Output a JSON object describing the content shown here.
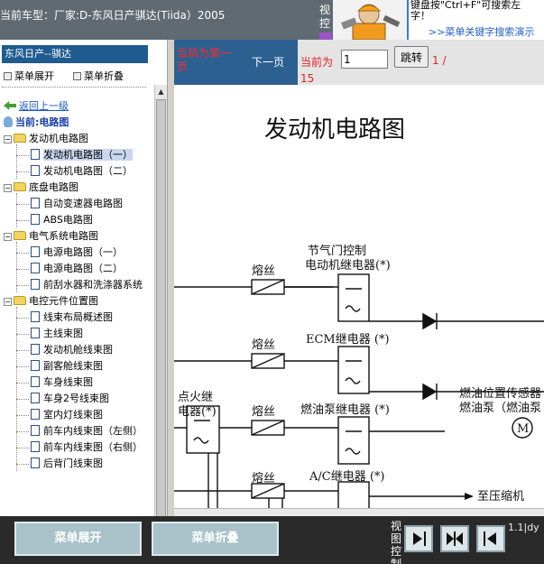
{
  "header": {
    "title": "当前车型：厂家:D-东风日产骐达(Tiida）2005",
    "view_control": "视控",
    "tip_line1": "键盘按\"Ctrl+F\"可搜索左",
    "tip_line2": "字！",
    "tip_link": ">>菜单关键字搜索演示"
  },
  "sidebar": {
    "car_title": "东风日产--骐达",
    "expand_label": "菜单展开",
    "collapse_label": "菜单折叠",
    "back_label": "返回上一级",
    "current_label": "当前:电路图",
    "groups": [
      {
        "label": "发动机电路图",
        "items": [
          "发动机电路图（一）",
          "发动机电路图（二）"
        ]
      },
      {
        "label": "底盘电路图",
        "items": [
          "自动变速器电路图",
          "ABS电路图"
        ]
      },
      {
        "label": "电气系统电路图",
        "items": [
          "电源电路图（一）",
          "电源电路图（二）",
          "前刮水器和洗涤器系统"
        ]
      },
      {
        "label": "电控元件位置图",
        "items": [
          "线束布局概述图",
          "主线束图",
          "发动机舱线束图",
          "副客舱线束图",
          "车身线束图",
          "车身2号线束图",
          "室内灯线束图",
          "前车内线束图（左侧）",
          "前车内线束图（右侧）",
          "后背门线束图"
        ]
      }
    ],
    "selected_item": "发动机电路图（一）"
  },
  "pager": {
    "first_label": "当前为第一页",
    "next_label": "下一页",
    "current_prefix": "当前为",
    "page_value": "1",
    "jump_label": "跳转",
    "pages_a": "1 /",
    "pages_b": "15"
  },
  "diagram": {
    "title": "发动机电路图",
    "labels": {
      "throttle": "节气门控制",
      "motor_relay": "电动机继电器(*)",
      "fuse1": "熔丝",
      "ecm_relay": "ECM继电器 (*)",
      "fuse2": "熔丝",
      "ign_relay1": "点火继",
      "ign_relay2": "电器(*)",
      "fuse3": "熔丝",
      "fuel_pump_relay": "燃油泵继电器 (*)",
      "fuel_sensor1": "燃油位置传感器",
      "fuel_sensor2": "燃油泵（燃油泵",
      "motor_symbol": "M",
      "fuse4": "熔丝",
      "ac_relay": "A/C继电器 (*)",
      "to_compressor": "至压缩机"
    }
  },
  "footer": {
    "expand_button": "菜单展开",
    "collapse_button": "菜单折叠",
    "view_control": "视图控制",
    "zoom_label": "1.1|dy"
  },
  "colors": {
    "sidebar_title_bg": "#1e5b8f",
    "pager_bg": "#2c6091",
    "alert_red": "#e02020",
    "button_face": "#a9c2c9"
  }
}
